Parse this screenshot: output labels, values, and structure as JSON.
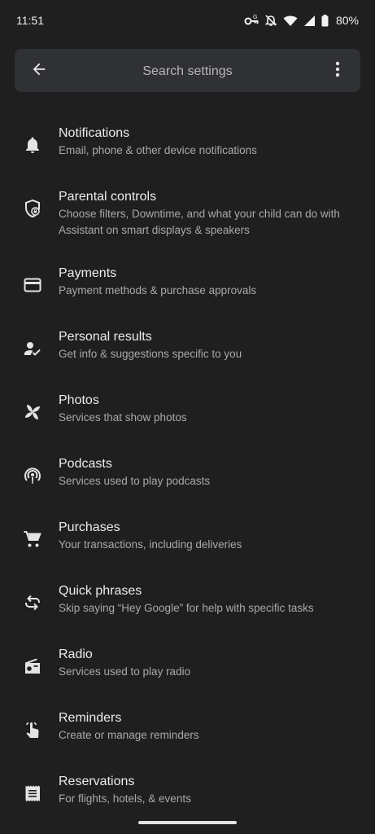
{
  "status_bar": {
    "time": "11:51",
    "battery": "80%",
    "icons": [
      "vpn-key-icon",
      "notifications-off-icon",
      "wifi-icon",
      "signal-icon",
      "battery-icon"
    ]
  },
  "search": {
    "placeholder": "Search settings",
    "back_icon": "arrow-back-icon",
    "more_icon": "more-vert-icon"
  },
  "settings": [
    {
      "title": "Notifications",
      "subtitle": "Email, phone & other device notifications",
      "icon": "bell-icon"
    },
    {
      "title": "Parental controls",
      "subtitle": "Choose filters, Downtime, and what your child can do with Assistant on smart displays & speakers",
      "icon": "shield-lock-icon"
    },
    {
      "title": "Payments",
      "subtitle": "Payment methods & purchase approvals",
      "icon": "credit-card-icon"
    },
    {
      "title": "Personal results",
      "subtitle": "Get info & suggestions specific to you",
      "icon": "person-check-icon"
    },
    {
      "title": "Photos",
      "subtitle": "Services that show photos",
      "icon": "pinwheel-icon"
    },
    {
      "title": "Podcasts",
      "subtitle": "Services used to play podcasts",
      "icon": "podcast-icon"
    },
    {
      "title": "Purchases",
      "subtitle": "Your transactions, including deliveries",
      "icon": "cart-icon"
    },
    {
      "title": "Quick phrases",
      "subtitle": "Skip saying “Hey Google” for help with specific tasks",
      "icon": "repeat-icon"
    },
    {
      "title": "Radio",
      "subtitle": "Services used to play radio",
      "icon": "radio-icon"
    },
    {
      "title": "Reminders",
      "subtitle": "Create or manage reminders",
      "icon": "reminder-hand-icon"
    },
    {
      "title": "Reservations",
      "subtitle": "For flights, hotels, & events",
      "icon": "receipt-icon"
    }
  ]
}
